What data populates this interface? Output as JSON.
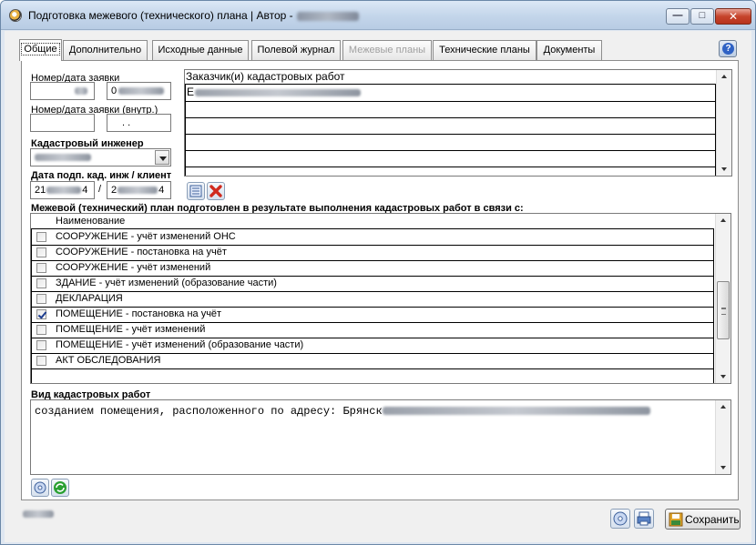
{
  "window": {
    "title": "Подготовка межевого (технического) плана | Автор -",
    "minimize_glyph": "—",
    "maximize_glyph": "□",
    "close_glyph": "✕"
  },
  "tabs": [
    {
      "label": "Общие",
      "active": true
    },
    {
      "label": "Дополнительно"
    },
    {
      "label": "Исходные данные"
    },
    {
      "label": "Полевой журнал"
    },
    {
      "label": "Межевые планы",
      "disabled": true
    },
    {
      "label": "Технические планы"
    },
    {
      "label": "Документы"
    }
  ],
  "help_glyph": "?",
  "form": {
    "request_label": "Номер/дата заявки",
    "request_number": "",
    "request_date": "0",
    "request_internal_label": "Номер/дата заявки (внутр.)",
    "request_internal_number": "",
    "request_internal_date": ". .",
    "engineer_label": "Кадастровый инженер",
    "sign_date_label": "Дата подп. кад. инж / клиент",
    "sign_date_engineer": "21",
    "sign_date_engineer_end": "4",
    "slash": "/",
    "sign_date_client": "2",
    "sign_date_client_end": "4",
    "customers_label": "Заказчик(и) кадастровых работ",
    "customer_first": "Е"
  },
  "reasons": {
    "label": "Межевой (технический) план подготовлен в результате выполнения кадастровых работ в связи с:",
    "column_header": "Наименование",
    "items": [
      {
        "text": "СООРУЖЕНИЕ - учёт изменений ОНС",
        "checked": false
      },
      {
        "text": "СООРУЖЕНИЕ - постановка на учёт",
        "checked": false
      },
      {
        "text": "СООРУЖЕНИЕ - учёт изменений",
        "checked": false
      },
      {
        "text": "ЗДАНИЕ - учёт изменений (образование части)",
        "checked": false
      },
      {
        "text": "ДЕКЛАРАЦИЯ",
        "checked": false
      },
      {
        "text": "ПОМЕЩЕНИЕ - постановка на учёт",
        "checked": true
      },
      {
        "text": "ПОМЕЩЕНИЕ - учёт изменений",
        "checked": false
      },
      {
        "text": "ПОМЕЩЕНИЕ - учёт изменений (образование части)",
        "checked": false
      },
      {
        "text": "АКТ ОБСЛЕДОВАНИЯ",
        "checked": false
      }
    ]
  },
  "work_type": {
    "label": "Вид кадастровых работ",
    "text": "созданием помещения, расположенного по адресу: Брянск"
  },
  "footer": {
    "save_label": "Сохранить"
  },
  "colors": {
    "accent": "#2f62c4",
    "delete_red": "#d02a1e",
    "green_icon": "#2aa032"
  }
}
